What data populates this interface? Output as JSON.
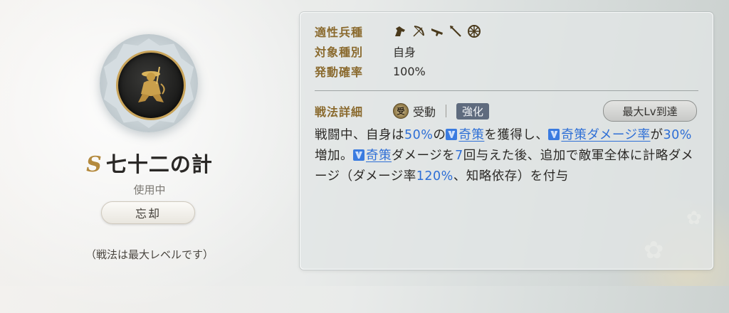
{
  "skill": {
    "rank": "S",
    "name": "七十二の計",
    "status": "使用中",
    "forget_label": "忘却",
    "max_level_note": "（戦法は最大レベルです）"
  },
  "details": {
    "troop_label": "適性兵種",
    "troop_icons": [
      "cavalry-icon",
      "bow-icon",
      "rifle-icon",
      "spear-icon",
      "shield-icon"
    ],
    "target_label": "対象種別",
    "target_value": "自身",
    "rate_label": "発動確率",
    "rate_value": "100%",
    "tactic_label": "戦法詳細",
    "type_value": "受動",
    "boost_tag": "強化",
    "max_lv_badge": "最大Lv到達",
    "description": {
      "p1": "戦闘中、自身は",
      "v1": "50%",
      "p2": "の",
      "kw1": "奇策",
      "p3": "を獲得し、",
      "kw2": "奇策ダメージ率",
      "p4": "が",
      "v2": "30%",
      "p5": "増加。",
      "kw3": "奇策",
      "p6": "ダメージを",
      "v3": "7",
      "p7": "回与えた後、追加で敵軍全体に計略ダメージ（ダメージ率",
      "v4": "120%",
      "p8": "、知略依存）を付与"
    }
  },
  "colors": {
    "accent_gold": "#8a6a2e",
    "highlight_blue": "#2e6fd6",
    "boost_tag_bg": "#5f6b7e"
  }
}
